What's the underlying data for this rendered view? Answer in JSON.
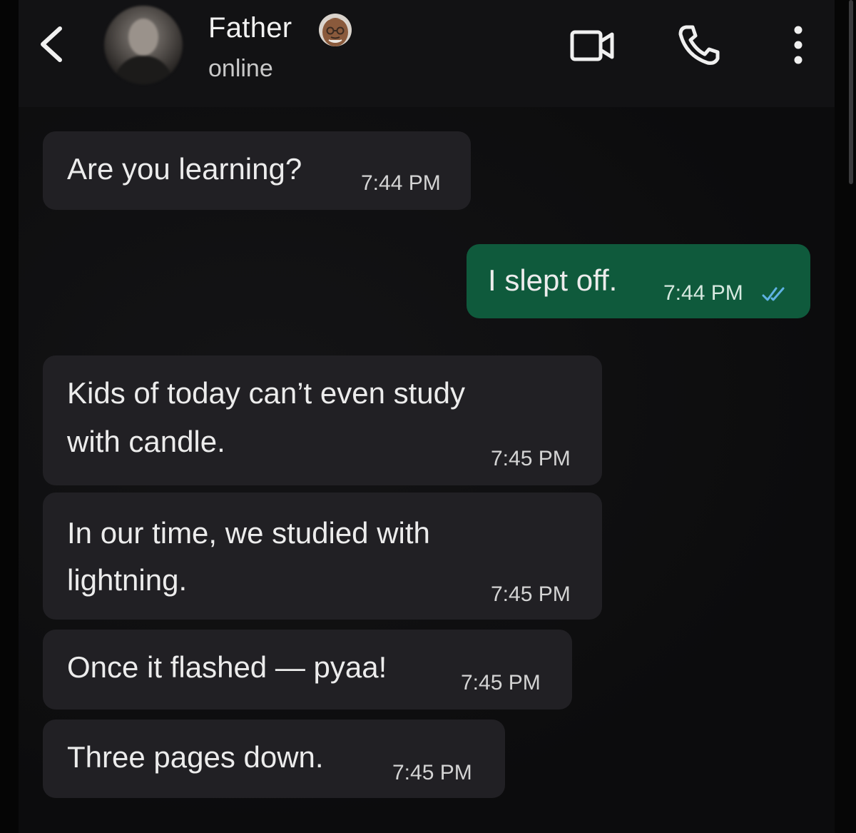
{
  "header": {
    "contact_name": "Father",
    "status": "online",
    "name_emoji": "old-man-face-emoji",
    "icons": [
      "back-chevron-icon",
      "video-camera-icon",
      "phone-icon",
      "more-vertical-icon"
    ]
  },
  "messages": [
    {
      "direction": "incoming",
      "text": "Are you learning?",
      "time": "7:44 PM"
    },
    {
      "direction": "outgoing",
      "text": "I slept off.",
      "time": "7:44 PM",
      "read_receipt": "double-check"
    },
    {
      "direction": "incoming",
      "lines": [
        "Kids of today can’t even study",
        "with candle."
      ],
      "time": "7:45 PM"
    },
    {
      "direction": "incoming",
      "lines": [
        "In our time, we studied with",
        "lightning."
      ],
      "time": "7:45 PM"
    },
    {
      "direction": "incoming",
      "text": "Once it flashed — pyaa!",
      "time": "7:45 PM"
    },
    {
      "direction": "incoming",
      "text": "Three pages down.",
      "time": "7:45 PM"
    }
  ],
  "colors": {
    "header_bg": "#121214",
    "chat_bg": "#0c0c0d",
    "incoming_bubble": "#212024",
    "outgoing_bubble": "#0f5a3c",
    "read_tick": "#5fb2e4"
  }
}
